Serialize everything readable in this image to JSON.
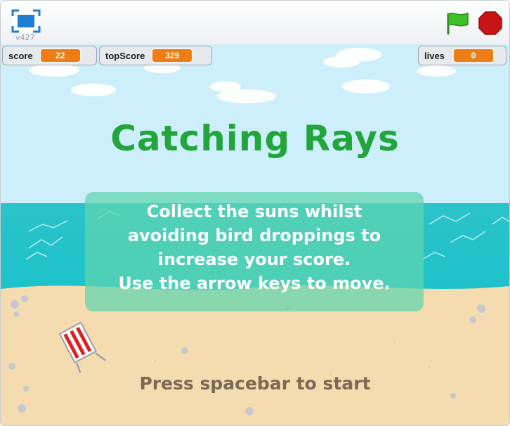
{
  "player": {
    "version": "v427"
  },
  "monitors": {
    "score": {
      "label": "score",
      "value": "22"
    },
    "topScore": {
      "label": "topScore",
      "value": "329"
    },
    "lives": {
      "label": "lives",
      "value": "0"
    }
  },
  "stage": {
    "title": "Catching Rays",
    "instructions": [
      "Collect the suns whilst",
      "avoiding bird droppings to",
      "increase your score.",
      "Use the arrow keys to move."
    ],
    "prompt": "Press spacebar to start"
  },
  "colors": {
    "title": "#22a53b",
    "monitor_value": "#ee7d16",
    "sky": "#cdeefb",
    "sea": "#17c1cc",
    "sand": "#f5dcb0",
    "flag": "#3fbf28",
    "stop": "#c81414"
  },
  "icons": {
    "fullscreen": "fullscreen-icon",
    "flag": "green-flag-icon",
    "stop": "stop-icon"
  }
}
